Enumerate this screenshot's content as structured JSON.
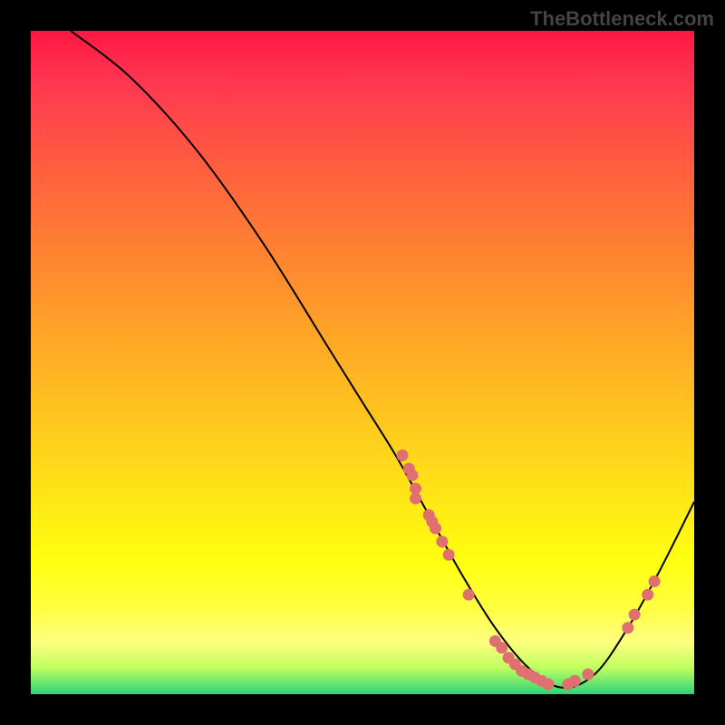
{
  "watermark": "TheBottleneck.com",
  "chart_data": {
    "type": "line",
    "title": "",
    "xlabel": "",
    "ylabel": "",
    "xlim": [
      0,
      100
    ],
    "ylim": [
      0,
      100
    ],
    "series": [
      {
        "name": "curve",
        "x": [
          6,
          15,
          25,
          35,
          45,
          50,
          55,
          60,
          65,
          70,
          75,
          80,
          85,
          90,
          95,
          100
        ],
        "y": [
          100,
          93,
          82,
          68,
          52,
          44,
          36,
          27,
          18,
          10,
          4,
          1,
          3,
          10,
          19,
          29
        ]
      }
    ],
    "scatter_points": [
      {
        "x": 56,
        "y": 36
      },
      {
        "x": 57,
        "y": 34
      },
      {
        "x": 57.5,
        "y": 33
      },
      {
        "x": 58,
        "y": 31
      },
      {
        "x": 58,
        "y": 29.5
      },
      {
        "x": 60,
        "y": 27
      },
      {
        "x": 60.5,
        "y": 26
      },
      {
        "x": 61,
        "y": 25
      },
      {
        "x": 62,
        "y": 23
      },
      {
        "x": 63,
        "y": 21
      },
      {
        "x": 66,
        "y": 15
      },
      {
        "x": 70,
        "y": 8
      },
      {
        "x": 71,
        "y": 7
      },
      {
        "x": 72,
        "y": 5.5
      },
      {
        "x": 73,
        "y": 4.5
      },
      {
        "x": 74,
        "y": 3.5
      },
      {
        "x": 75,
        "y": 3
      },
      {
        "x": 76,
        "y": 2.5
      },
      {
        "x": 77,
        "y": 2
      },
      {
        "x": 78,
        "y": 1.5
      },
      {
        "x": 81,
        "y": 1.5
      },
      {
        "x": 82,
        "y": 2
      },
      {
        "x": 84,
        "y": 3
      },
      {
        "x": 90,
        "y": 10
      },
      {
        "x": 91,
        "y": 12
      },
      {
        "x": 93,
        "y": 15
      },
      {
        "x": 94,
        "y": 17
      }
    ],
    "gradient_colors": {
      "top": "#ff1744",
      "middle": "#ffe018",
      "bottom": "#2dd478"
    }
  }
}
